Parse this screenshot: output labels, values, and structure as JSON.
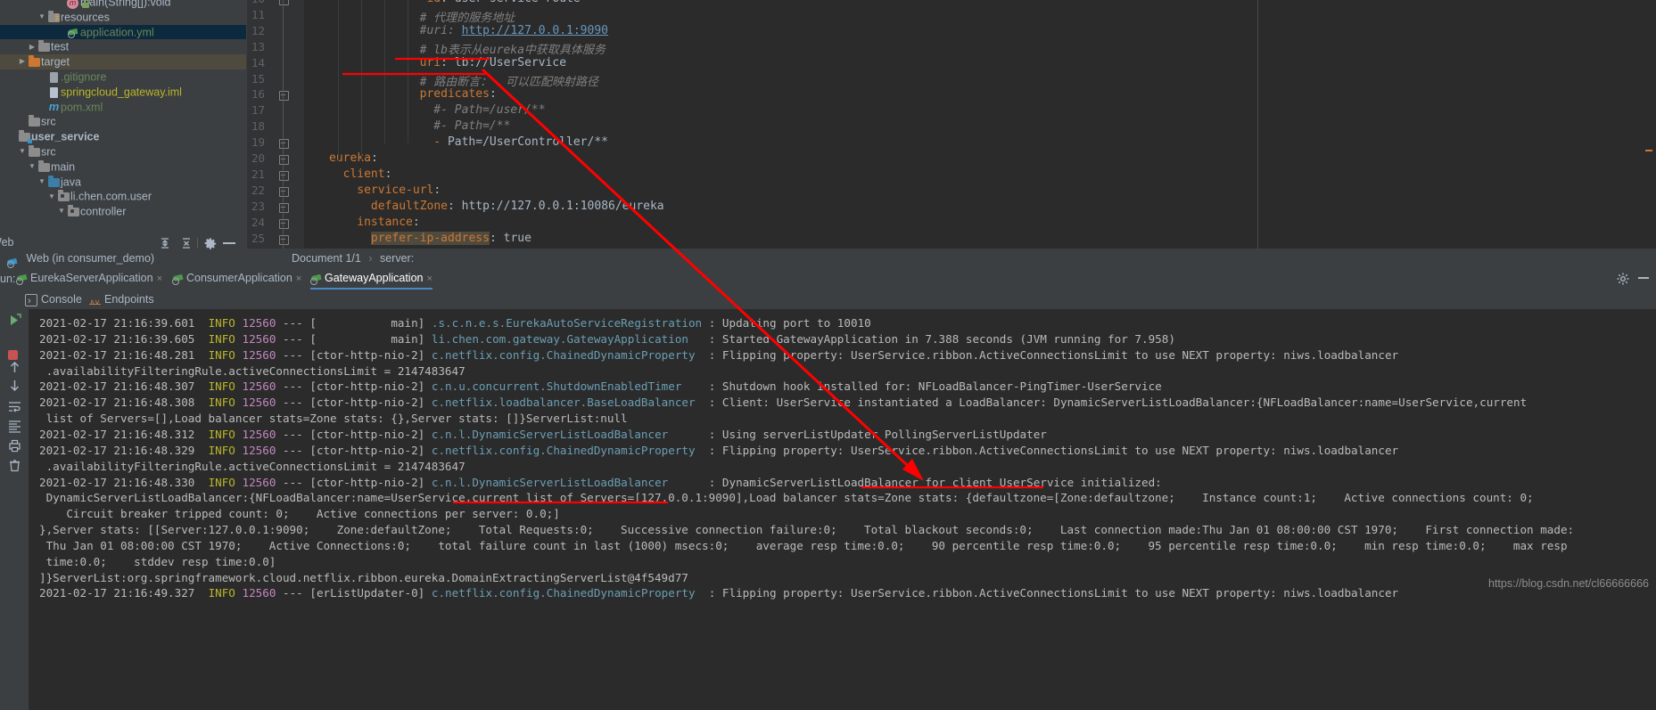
{
  "project_tree": {
    "items": [
      {
        "indent": 5,
        "arrow": "",
        "icon": "method-icon",
        "label": "main(String[]):void",
        "style": "gray",
        "selected": false
      },
      {
        "indent": 3,
        "arrow": "▼",
        "icon": "resources-folder-icon",
        "label": "resources",
        "style": "plain",
        "selected": false
      },
      {
        "indent": 5,
        "arrow": "",
        "icon": "yml-file-icon",
        "label": "application.yml",
        "style": "green",
        "selected": true
      },
      {
        "indent": 2,
        "arrow": "▶",
        "icon": "folder-icon",
        "label": "test",
        "style": "plain",
        "selected": false
      },
      {
        "indent": 1,
        "arrow": "▶",
        "icon": "target-folder-icon",
        "label": "target",
        "style": "orange",
        "selected2": true
      },
      {
        "indent": 3,
        "arrow": "",
        "icon": "gitignore-file-icon",
        "label": ".gitignore",
        "style": "green",
        "selected": false
      },
      {
        "indent": 3,
        "arrow": "",
        "icon": "iml-file-icon",
        "label": "springcloud_gateway.iml",
        "style": "yellow",
        "selected": false
      },
      {
        "indent": 3,
        "arrow": "",
        "icon": "maven-pom-icon",
        "label": "pom.xml",
        "style": "green",
        "selected": false
      },
      {
        "indent": 1,
        "arrow": "",
        "icon": "folder-icon",
        "label": "src",
        "style": "plain",
        "selected": false
      },
      {
        "indent": 0,
        "arrow": "",
        "icon": "module-icon",
        "label": "user_service",
        "style": "bold",
        "selected": false
      },
      {
        "indent": 1,
        "arrow": "▼",
        "icon": "folder-icon",
        "label": "src",
        "style": "plain",
        "selected": false
      },
      {
        "indent": 2,
        "arrow": "▼",
        "icon": "folder-icon",
        "label": "main",
        "style": "plain",
        "selected": false
      },
      {
        "indent": 3,
        "arrow": "▼",
        "icon": "java-source-folder-icon",
        "label": "java",
        "style": "plain",
        "selected": false
      },
      {
        "indent": 4,
        "arrow": "▼",
        "icon": "package-icon",
        "label": "li.chen.com.user",
        "style": "plain",
        "selected": false
      },
      {
        "indent": 5,
        "arrow": "▼",
        "icon": "package-icon",
        "label": "controller",
        "style": "plain",
        "selected": false
      }
    ]
  },
  "tree_toolbar": {
    "web_label": "Web",
    "expand_all_tooltip": "Expand All",
    "collapse_all_tooltip": "Collapse All",
    "settings_tooltip": "Settings",
    "hide_tooltip": "Hide"
  },
  "web_toolwindow": {
    "entry": "Web (in consumer_demo)"
  },
  "editor": {
    "first_line_number": 10,
    "lines": [
      {
        "n": 10,
        "fold": true,
        "indent": 12,
        "parts": [
          {
            "t": "- ",
            "c": "key"
          },
          {
            "t": "id",
            "c": "key"
          },
          {
            "t": ": ",
            "c": "txt"
          },
          {
            "t": "user-service-route",
            "c": "txt"
          }
        ]
      },
      {
        "n": 11,
        "fold": false,
        "indent": 13,
        "parts": [
          {
            "t": "# 代理的服务地址",
            "c": "com"
          }
        ]
      },
      {
        "n": 12,
        "fold": false,
        "indent": 13,
        "parts": [
          {
            "t": "#uri: ",
            "c": "com"
          },
          {
            "t": "http://127.0.0.1:9090",
            "c": "lnk"
          }
        ]
      },
      {
        "n": 13,
        "fold": false,
        "indent": 13,
        "parts": [
          {
            "t": "# lb表示从eureka中获取具体服务",
            "c": "com"
          }
        ]
      },
      {
        "n": 14,
        "fold": false,
        "indent": 13,
        "parts": [
          {
            "t": "uri",
            "c": "key"
          },
          {
            "t": ": ",
            "c": "txt"
          },
          {
            "t": "lb://UserService",
            "c": "txt"
          }
        ]
      },
      {
        "n": 15,
        "fold": false,
        "indent": 13,
        "parts": [
          {
            "t": "# 路由断言：  可以匹配映射路径",
            "c": "com"
          }
        ]
      },
      {
        "n": 16,
        "fold": true,
        "indent": 13,
        "parts": [
          {
            "t": "predicates",
            "c": "key"
          },
          {
            "t": ":",
            "c": "txt"
          }
        ]
      },
      {
        "n": 17,
        "fold": false,
        "indent": 15,
        "parts": [
          {
            "t": "#- Path=/user/**",
            "c": "com"
          }
        ]
      },
      {
        "n": 18,
        "fold": false,
        "indent": 15,
        "parts": [
          {
            "t": "#- Path=/**",
            "c": "com"
          }
        ]
      },
      {
        "n": 19,
        "fold": true,
        "indent": 15,
        "parts": [
          {
            "t": "- ",
            "c": "key"
          },
          {
            "t": "Path=/UserController/**",
            "c": "txt"
          }
        ]
      },
      {
        "n": 20,
        "fold": true,
        "indent": 0,
        "parts": [
          {
            "t": "eureka",
            "c": "key"
          },
          {
            "t": ":",
            "c": "txt"
          }
        ]
      },
      {
        "n": 21,
        "fold": true,
        "indent": 2,
        "parts": [
          {
            "t": "client",
            "c": "key"
          },
          {
            "t": ":",
            "c": "txt"
          }
        ]
      },
      {
        "n": 22,
        "fold": true,
        "indent": 4,
        "parts": [
          {
            "t": "service-url",
            "c": "key"
          },
          {
            "t": ":",
            "c": "txt"
          }
        ]
      },
      {
        "n": 23,
        "fold": true,
        "indent": 6,
        "parts": [
          {
            "t": "defaultZone",
            "c": "key"
          },
          {
            "t": ": ",
            "c": "txt"
          },
          {
            "t": "http://127.0.0.1:10086/eureka",
            "c": "txt"
          }
        ]
      },
      {
        "n": 24,
        "fold": true,
        "indent": 4,
        "parts": [
          {
            "t": "instance",
            "c": "key"
          },
          {
            "t": ":",
            "c": "txt"
          }
        ]
      },
      {
        "n": 25,
        "fold": true,
        "indent": 6,
        "parts": [
          {
            "t": "prefer-ip-address",
            "c": "keyhl"
          },
          {
            "t": ": ",
            "c": "txt"
          },
          {
            "t": "true",
            "c": "txt"
          }
        ]
      }
    ]
  },
  "breadcrumb": {
    "document": "Document 1/1",
    "separator": "›",
    "node": "server:"
  },
  "run_window": {
    "run_label": "un:",
    "tabs": [
      {
        "label": "EurekaServerApplication",
        "close": "×",
        "active": false
      },
      {
        "label": "ConsumerApplication",
        "close": "×",
        "active": false
      },
      {
        "label": "GatewayApplication",
        "close": "×",
        "active": true
      }
    ],
    "subtabs": [
      {
        "label": "Console",
        "active": true
      },
      {
        "label": "Endpoints",
        "active": false
      }
    ],
    "settings_icon": "gear-icon",
    "minimize_icon": "minimize-icon"
  },
  "console": {
    "lines": [
      {
        "y": 0,
        "type": "log",
        "ts": "2021-02-17 21:16:39.601",
        "level": "INFO",
        "pid": "12560",
        "thread": "[           main]",
        "cls": ".s.c.n.e.s.EurekaAutoServiceRegistration",
        "pad": 0,
        "msg": ": Updating port to 10010"
      },
      {
        "y": 1,
        "type": "log",
        "ts": "2021-02-17 21:16:39.605",
        "level": "INFO",
        "pid": "12560",
        "thread": "[           main]",
        "cls": "li.chen.com.gateway.GatewayApplication",
        "pad": 2,
        "msg": ": Started GatewayApplication in 7.388 seconds (JVM running for 7.958)"
      },
      {
        "y": 2,
        "type": "log",
        "ts": "2021-02-17 21:16:48.281",
        "level": "INFO",
        "pid": "12560",
        "thread": "[ctor-http-nio-2]",
        "cls": "c.netflix.config.ChainedDynamicProperty",
        "pad": 1,
        "msg": ": Flipping property: UserService.ribbon.ActiveConnectionsLimit to use NEXT property: niws.loadbalancer"
      },
      {
        "y": 3,
        "type": "cont",
        "text": " .availabilityFilteringRule.activeConnectionsLimit = 2147483647"
      },
      {
        "y": 4,
        "type": "log",
        "ts": "2021-02-17 21:16:48.307",
        "level": "INFO",
        "pid": "12560",
        "thread": "[ctor-http-nio-2]",
        "cls": "c.n.u.concurrent.ShutdownEnabledTimer",
        "pad": 3,
        "msg": ": Shutdown hook installed for: NFLoadBalancer-PingTimer-UserService"
      },
      {
        "y": 5,
        "type": "log",
        "ts": "2021-02-17 21:16:48.308",
        "level": "INFO",
        "pid": "12560",
        "thread": "[ctor-http-nio-2]",
        "cls": "c.netflix.loadbalancer.BaseLoadBalancer",
        "pad": 1,
        "msg": ": Client: UserService instantiated a LoadBalancer: DynamicServerListLoadBalancer:{NFLoadBalancer:name=UserService,current"
      },
      {
        "y": 6,
        "type": "cont",
        "text": " list of Servers=[],Load balancer stats=Zone stats: {},Server stats: []}ServerList:null"
      },
      {
        "y": 7,
        "type": "log",
        "ts": "2021-02-17 21:16:48.312",
        "level": "INFO",
        "pid": "12560",
        "thread": "[ctor-http-nio-2]",
        "cls": "c.n.l.DynamicServerListLoadBalancer",
        "pad": 5,
        "msg": ": Using serverListUpdater PollingServerListUpdater"
      },
      {
        "y": 8,
        "type": "log",
        "ts": "2021-02-17 21:16:48.329",
        "level": "INFO",
        "pid": "12560",
        "thread": "[ctor-http-nio-2]",
        "cls": "c.netflix.config.ChainedDynamicProperty",
        "pad": 1,
        "msg": ": Flipping property: UserService.ribbon.ActiveConnectionsLimit to use NEXT property: niws.loadbalancer"
      },
      {
        "y": 9,
        "type": "cont",
        "text": " .availabilityFilteringRule.activeConnectionsLimit = 2147483647"
      },
      {
        "y": 10,
        "type": "log",
        "ts": "2021-02-17 21:16:48.330",
        "level": "INFO",
        "pid": "12560",
        "thread": "[ctor-http-nio-2]",
        "cls": "c.n.l.DynamicServerListLoadBalancer",
        "pad": 5,
        "msg": ": DynamicServerListLoadBalancer for client UserService initialized:"
      },
      {
        "y": 11,
        "type": "cont",
        "text": " DynamicServerListLoadBalancer:{NFLoadBalancer:name=UserService,current list of Servers=[127.0.0.1:9090],Load balancer stats=Zone stats: {defaultzone=[Zone:defaultzone;\tInstance count:1;\tActive connections count: 0;"
      },
      {
        "y": 12,
        "type": "cont",
        "text": "    Circuit breaker tripped count: 0;\tActive connections per server: 0.0;]"
      },
      {
        "y": 13,
        "type": "cont",
        "text": "},Server stats: [[Server:127.0.0.1:9090;\tZone:defaultZone;\tTotal Requests:0;\tSuccessive connection failure:0;\tTotal blackout seconds:0;\tLast connection made:Thu Jan 01 08:00:00 CST 1970;\tFirst connection made:"
      },
      {
        "y": 14,
        "type": "cont",
        "text": " Thu Jan 01 08:00:00 CST 1970;\tActive Connections:0;\ttotal failure count in last (1000) msecs:0;\taverage resp time:0.0;\t90 percentile resp time:0.0;\t95 percentile resp time:0.0;\tmin resp time:0.0;\tmax resp"
      },
      {
        "y": 15,
        "type": "cont",
        "text": " time:0.0;\tstddev resp time:0.0]"
      },
      {
        "y": 16,
        "type": "cont",
        "text": "]}ServerList:org.springframework.cloud.netflix.ribbon.eureka.DomainExtractingServerList@4f549d77"
      },
      {
        "y": 17,
        "type": "log",
        "ts": "2021-02-17 21:16:49.327",
        "level": "INFO",
        "pid": "12560",
        "thread": "[erListUpdater-0]",
        "cls": "c.netflix.config.ChainedDynamicProperty",
        "pad": 1,
        "msg": ": Flipping property: UserService.ribbon.ActiveConnectionsLimit to use NEXT property: niws.loadbalancer"
      }
    ]
  },
  "annotations": {
    "color": "#ff0000",
    "underline_comment_label": "eureka中获取具体服务",
    "underline_uri_label": "uri: lb://UserService",
    "underline_client_label": "UserService initialized:",
    "underline_servers_label": "current list of Servers=[127.0.0.1:9090]"
  },
  "watermark": {
    "text": "https://blog.csdn.net/cl66666666"
  }
}
